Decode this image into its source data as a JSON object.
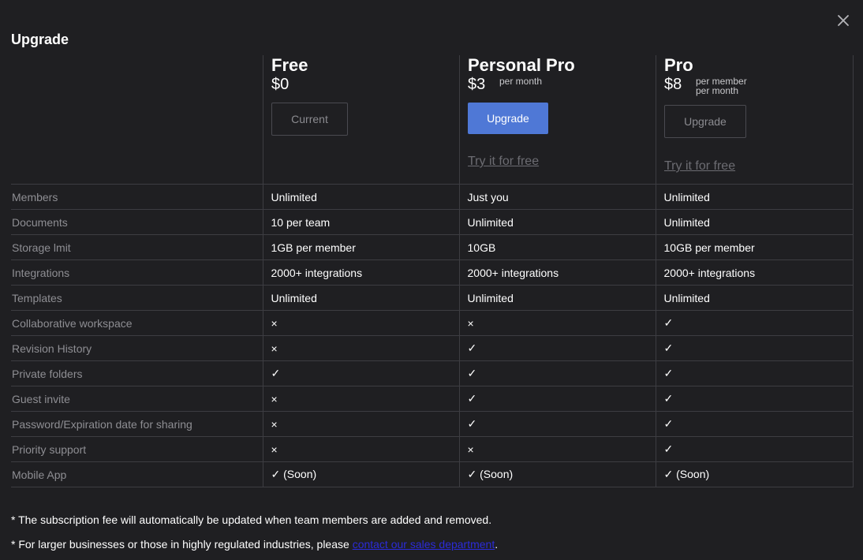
{
  "modal": {
    "title": "Upgrade"
  },
  "plans": [
    {
      "name": "Free",
      "price": "$0",
      "period": "",
      "button_label": "Current",
      "button_style": "outline",
      "trial_link": ""
    },
    {
      "name": "Personal Pro",
      "price": "$3",
      "period": "per month",
      "button_label": "Upgrade",
      "button_style": "primary",
      "trial_link": "Try it for free"
    },
    {
      "name": "Pro",
      "price": "$8",
      "period": "per member\nper month",
      "button_label": "Upgrade",
      "button_style": "outline",
      "trial_link": "Try it for free"
    }
  ],
  "features": [
    {
      "label": "Members",
      "values": [
        "Unlimited",
        "Just you",
        "Unlimited"
      ]
    },
    {
      "label": "Documents",
      "values": [
        "10 per team",
        "Unlimited",
        "Unlimited"
      ]
    },
    {
      "label": "Storage lmit",
      "values": [
        "1GB per member",
        "10GB",
        "10GB per member"
      ]
    },
    {
      "label": "Integrations",
      "values": [
        "2000+ integrations",
        "2000+ integrations",
        "2000+ integrations"
      ]
    },
    {
      "label": "Templates",
      "values": [
        "Unlimited",
        "Unlimited",
        "Unlimited"
      ]
    },
    {
      "label": "Collaborative workspace",
      "values": [
        "×",
        "×",
        "✓"
      ]
    },
    {
      "label": "Revision History",
      "values": [
        "×",
        "✓",
        "✓"
      ]
    },
    {
      "label": "Private folders",
      "values": [
        "✓",
        "✓",
        "✓"
      ]
    },
    {
      "label": "Guest invite",
      "values": [
        "×",
        "✓",
        "✓"
      ]
    },
    {
      "label": "Password/Expiration date for sharing",
      "values": [
        "×",
        "✓",
        "✓"
      ]
    },
    {
      "label": "Priority support",
      "values": [
        "×",
        "×",
        "✓"
      ]
    },
    {
      "label": "Mobile App",
      "values": [
        "✓ (Soon)",
        "✓ (Soon)",
        "✓ (Soon)"
      ]
    }
  ],
  "footnotes": {
    "fee_note": "* The subscription fee will automatically be updated when team members are added and removed.",
    "business_note_prefix": "* For larger businesses or those in highly regulated industries, please ",
    "business_note_link": "contact our sales department",
    "business_note_suffix": "."
  },
  "icons": {
    "close": "close-icon"
  },
  "colors": {
    "background": "#1f1f22",
    "primary_button": "#4f78d6",
    "link": "#2b2bd9",
    "muted_text": "#8e8e93",
    "border": "#3d3d42"
  }
}
